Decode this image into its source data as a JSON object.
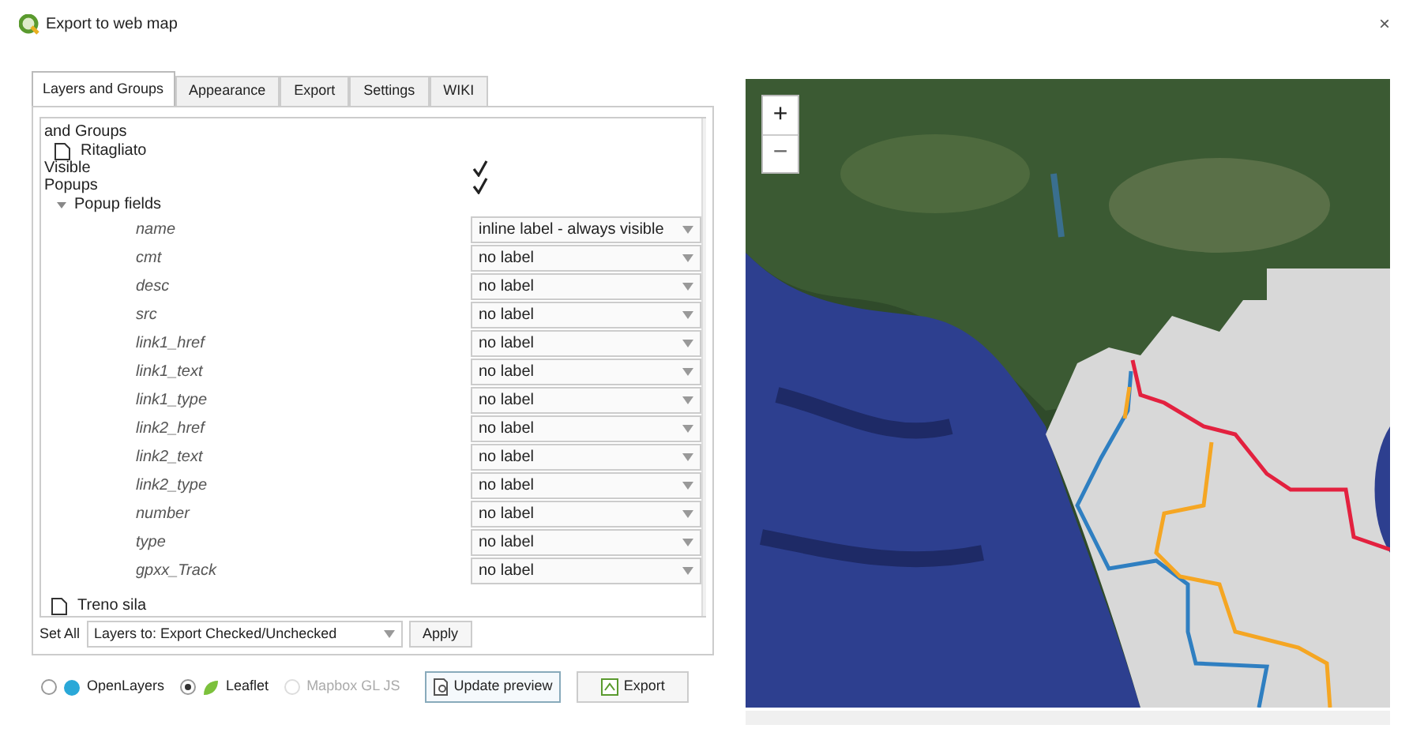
{
  "window": {
    "title": "Export to web map",
    "close": "×"
  },
  "tabs": [
    {
      "label": "Layers and Groups",
      "selected": true
    },
    {
      "label": "Appearance",
      "selected": false
    },
    {
      "label": "Export",
      "selected": false
    },
    {
      "label": "Settings",
      "selected": false
    },
    {
      "label": "WIKI",
      "selected": false
    }
  ],
  "tree": {
    "header": "and Groups",
    "layers": [
      {
        "name": "Ritagliato",
        "checked": false,
        "options": [
          {
            "label": "Visible",
            "checked": true
          },
          {
            "label": "Popups",
            "checked": true
          }
        ],
        "popup_fields": {
          "label": "Popup fields",
          "expanded": true,
          "fields": [
            {
              "name": "name",
              "value": "inline label - always visible"
            },
            {
              "name": "cmt",
              "value": "no label"
            },
            {
              "name": "desc",
              "value": "no label"
            },
            {
              "name": "src",
              "value": "no label"
            },
            {
              "name": "link1_href",
              "value": "no label"
            },
            {
              "name": "link1_text",
              "value": "no label"
            },
            {
              "name": "link1_type",
              "value": "no label"
            },
            {
              "name": "link2_href",
              "value": "no label"
            },
            {
              "name": "link2_text",
              "value": "no label"
            },
            {
              "name": "link2_type",
              "value": "no label"
            },
            {
              "name": "number",
              "value": "no label"
            },
            {
              "name": "type",
              "value": "no label"
            },
            {
              "name": "gpxx_Track",
              "value": "no label"
            }
          ]
        }
      },
      {
        "name": "Treno sila",
        "checked": false
      }
    ]
  },
  "set_all": {
    "label": "Set All",
    "value": "Layers to: Export Checked/Unchecked",
    "apply": "Apply"
  },
  "renderers": [
    {
      "label": "OpenLayers",
      "selected": false,
      "disabled": false
    },
    {
      "label": "Leaflet",
      "selected": true,
      "disabled": false
    },
    {
      "label": "Mapbox GL JS",
      "selected": false,
      "disabled": true
    }
  ],
  "buttons": {
    "update_preview": "Update preview",
    "export": "Export"
  },
  "map": {
    "kind": "picture",
    "zoom_in": "+",
    "zoom_out": "−"
  }
}
